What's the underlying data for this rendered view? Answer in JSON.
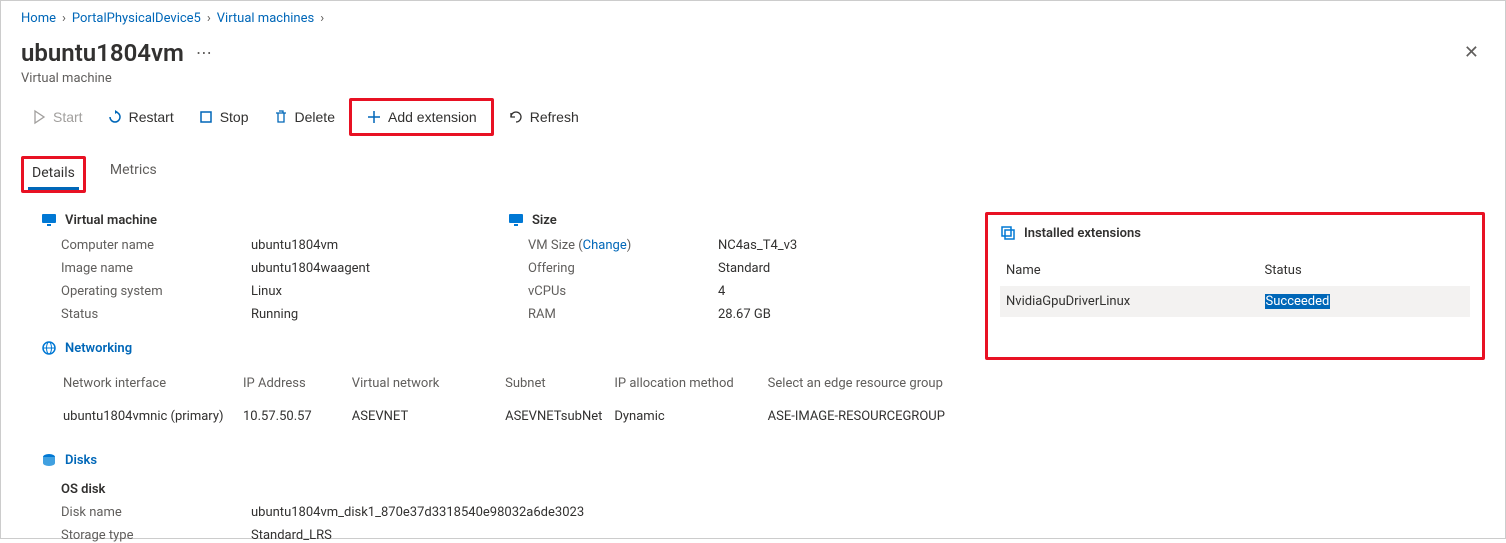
{
  "breadcrumb": {
    "items": [
      "Home",
      "PortalPhysicalDevice5",
      "Virtual machines"
    ]
  },
  "title": "ubuntu1804vm",
  "subtitle": "Virtual machine",
  "commands": {
    "start": "Start",
    "restart": "Restart",
    "stop": "Stop",
    "delete": "Delete",
    "add_extension": "Add extension",
    "refresh": "Refresh"
  },
  "tabs": {
    "details": "Details",
    "metrics": "Metrics"
  },
  "vm_section": {
    "title": "Virtual machine",
    "rows": {
      "computer_name_k": "Computer name",
      "computer_name_v": "ubuntu1804vm",
      "image_name_k": "Image name",
      "image_name_v": "ubuntu1804waagent",
      "os_k": "Operating system",
      "os_v": "Linux",
      "status_k": "Status",
      "status_v": "Running"
    }
  },
  "size_section": {
    "title": "Size",
    "rows": {
      "vmsize_k": "VM Size",
      "change": "Change",
      "vmsize_v": "NC4as_T4_v3",
      "offering_k": "Offering",
      "offering_v": "Standard",
      "vcpus_k": "vCPUs",
      "vcpus_v": "4",
      "ram_k": "RAM",
      "ram_v": "28.67 GB"
    }
  },
  "networking": {
    "title": "Networking",
    "headers": {
      "nic": "Network interface",
      "ip": "IP Address",
      "vnet": "Virtual network",
      "subnet": "Subnet",
      "ipalloc": "IP allocation method",
      "rg": "Select an edge resource group"
    },
    "row": {
      "nic": "ubuntu1804vmnic (primary)",
      "ip": "10.57.50.57",
      "vnet": "ASEVNET",
      "subnet": "ASEVNETsubNet",
      "ipalloc": "Dynamic",
      "rg": "ASE-IMAGE-RESOURCEGROUP"
    }
  },
  "disks": {
    "title": "Disks",
    "os_disk": "OS disk",
    "rows": {
      "name_k": "Disk name",
      "name_v": "ubuntu1804vm_disk1_870e37d3318540e98032a6de3023",
      "storage_k": "Storage type",
      "storage_v": "Standard_LRS"
    }
  },
  "extensions": {
    "title": "Installed extensions",
    "headers": {
      "name": "Name",
      "status": "Status"
    },
    "row": {
      "name": "NvidiaGpuDriverLinux",
      "status": "Succeeded"
    }
  }
}
